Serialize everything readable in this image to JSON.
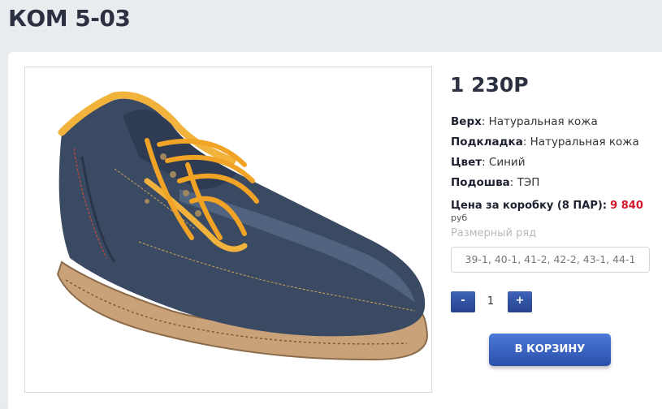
{
  "page": {
    "title": "КОМ 5-03",
    "price": "1 230Р"
  },
  "specs": [
    {
      "label": "Верх",
      "value": ": Натуральная кожа"
    },
    {
      "label": "Подкладка",
      "value": ": Натуральная кожа"
    },
    {
      "label": "Цвет",
      "value": ": Синий"
    },
    {
      "label": "Подошва",
      "value": ": ТЭП"
    }
  ],
  "box_price": {
    "label": "Цена за коробку (8 ПАР):",
    "value": "9 840",
    "currency": "руб"
  },
  "sizes": {
    "label": "Размерный ряд",
    "value": "39-1, 40-1, 41-2, 42-2, 43-1, 44-1"
  },
  "quantity": {
    "minus": "-",
    "value": "1",
    "plus": "+"
  },
  "cart_button": "В КОРЗИНУ",
  "colors": {
    "accent": "#2f52a6",
    "price_red": "#d2182b",
    "title": "#2b3140"
  },
  "icons": {
    "product_image": "blue-leather-shoe-with-yellow-laces"
  }
}
